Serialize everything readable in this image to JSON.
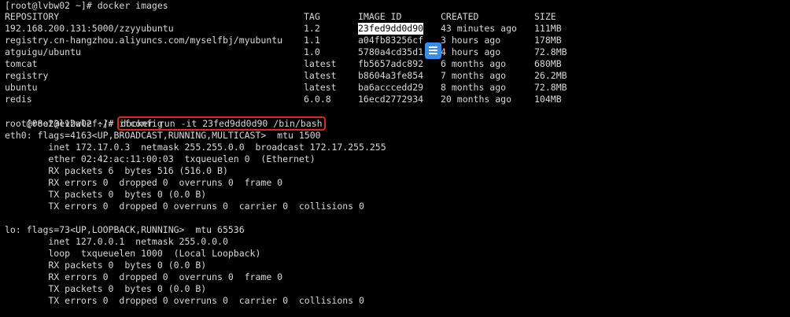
{
  "terminal": {
    "prompt1": "[root@lvbw02 ~]# docker images",
    "headers": [
      "REPOSITORY",
      "TAG",
      "IMAGE ID",
      "CREATED",
      "SIZE"
    ],
    "images": [
      {
        "repo": "192.168.200.131:5000/zzyyubuntu",
        "tag": "1.2",
        "id": "23fed9dd0d90",
        "created": "43 minutes ago",
        "size": "111MB"
      },
      {
        "repo": "registry.cn-hangzhou.aliyuncs.com/myselfbj/myubuntu",
        "tag": "1.1",
        "id": "a04fb83256cf",
        "created": "3 hours ago",
        "size": "178MB"
      },
      {
        "repo": "atguigu/ubuntu",
        "tag": "1.0",
        "id": "5780a4cd35d1",
        "created": "4 hours ago",
        "size": "72.8MB"
      },
      {
        "repo": "tomcat",
        "tag": "latest",
        "id": "fb5657adc892",
        "created": "6 months ago",
        "size": "680MB"
      },
      {
        "repo": "registry",
        "tag": "latest",
        "id": "b8604a3fe854",
        "created": "7 months ago",
        "size": "26.2MB"
      },
      {
        "repo": "ubuntu",
        "tag": "latest",
        "id": "ba6acccedd29",
        "created": "8 months ago",
        "size": "72.8MB"
      },
      {
        "repo": "redis",
        "tag": "6.0.8",
        "id": "16ecd2772934",
        "created": "20 months ago",
        "size": "104MB"
      }
    ],
    "prompt2": "[root@lvbw02 ~]# ",
    "run_command": "docker run -it 23fed9dd0d90 /bin/bash",
    "prompt3": "root@08e23e12alef:/# ifconfig",
    "output": [
      "eth0: flags=4163<UP,BROADCAST,RUNNING,MULTICAST>  mtu 1500",
      "        inet 172.17.0.3  netmask 255.255.0.0  broadcast 172.17.255.255",
      "        ether 02:42:ac:11:00:03  txqueuelen 0  (Ethernet)",
      "        RX packets 6  bytes 516 (516.0 B)",
      "        RX errors 0  dropped 0  overruns 0  frame 0",
      "        TX packets 0  bytes 0 (0.0 B)",
      "        TX errors 0  dropped 0 overruns 0  carrier 0  collisions 0",
      "",
      "lo: flags=73<UP,LOOPBACK,RUNNING>  mtu 65536",
      "        inet 127.0.0.1  netmask 255.0.0.0",
      "        loop  txqueuelen 1000  (Local Loopback)",
      "        RX packets 0  bytes 0 (0.0 B)",
      "        RX errors 0  dropped 0  overruns 0  frame 0",
      "        TX packets 0  bytes 0 (0.0 B)",
      "        TX errors 0  dropped 0 overruns 0  carrier 0  collisions 0"
    ]
  },
  "icons": {
    "overlay": "document-lines-icon"
  },
  "colors": {
    "background": "#000000",
    "text": "#d8d8d8",
    "highlight_box": "#e8231e",
    "overlay_icon": "#3b8ee6"
  }
}
